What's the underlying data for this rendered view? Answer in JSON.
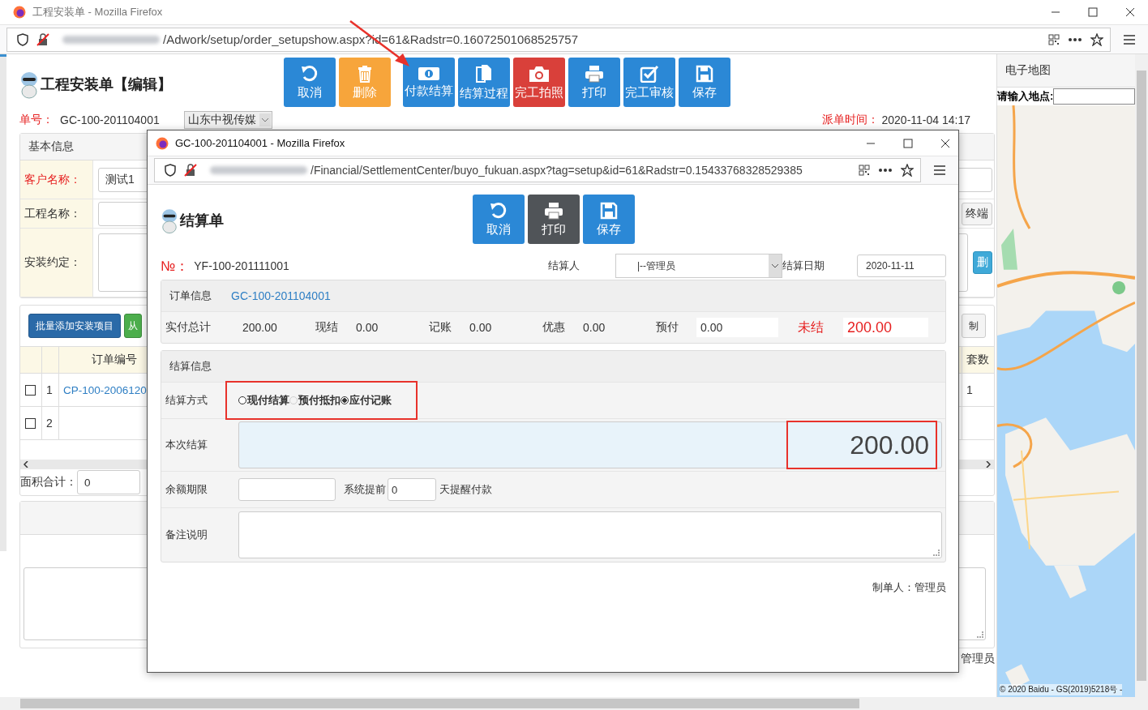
{
  "window": {
    "title": "工程安装单 - Mozilla Firefox",
    "url": "/Adwork/setup/order_setupshow.aspx?id=61&Radstr=0.16072501068525757"
  },
  "page": {
    "title": "工程安装单【编辑】",
    "toolbar": [
      {
        "label": "取消",
        "kind": "undo",
        "color": "#2b88d6",
        "pointed": false
      },
      {
        "label": "删除",
        "kind": "trash",
        "color": "#f7a53b",
        "pointed": false
      },
      {
        "label": "付款结算",
        "kind": "money",
        "color": "#2b88d6",
        "pointed": true
      },
      {
        "label": "结算过程",
        "kind": "document",
        "color": "#2b88d6",
        "pointed": false
      },
      {
        "label": "完工拍照",
        "kind": "camera",
        "color": "#d9403a",
        "pointed": false
      },
      {
        "label": "打印",
        "kind": "print",
        "color": "#2b88d6",
        "pointed": false
      },
      {
        "label": "完工审核",
        "kind": "check",
        "color": "#2b88d6",
        "pointed": false
      },
      {
        "label": "保存",
        "kind": "save",
        "color": "#2b88d6",
        "pointed": false
      }
    ],
    "order_no": {
      "label": "单号：",
      "value": "GC-100-201104001"
    },
    "company": {
      "value": "山东中视传媒"
    },
    "dispatch_time": {
      "label": "派单时间：",
      "value": "2020-11-04 14:17"
    },
    "basic_info": {
      "title": "基本信息",
      "fields": [
        {
          "label": "客户名称：",
          "required": true,
          "kind": "input",
          "value": "测试1"
        },
        {
          "label": "工程名称：",
          "required": false,
          "kind": "input",
          "button": {
            "label": "终端",
            "kind": "default"
          }
        },
        {
          "label": "安装约定：",
          "required": false,
          "kind": "textarea",
          "button": {
            "label": "删",
            "kind": "info"
          }
        }
      ]
    },
    "items": {
      "buttons": [
        {
          "label": "批量添加安装项目",
          "kind": "primary"
        },
        {
          "label": "从",
          "kind": "success"
        },
        {
          "label": "制",
          "kind": "default"
        }
      ],
      "columns": {
        "order_no": "订单编号",
        "sets": "套数"
      },
      "rows": [
        {
          "index": "1",
          "order_no": "CP-100-2006120",
          "sets": "1",
          "checked": false
        },
        {
          "index": "2",
          "checked": false
        }
      ],
      "area_total": {
        "label": "面积合计：",
        "value": "0"
      }
    },
    "footer": {
      "maker": "管理员"
    }
  },
  "map": {
    "title": "电子地图",
    "search_label": "请输入地点:",
    "copyright": "© 2020 Baidu - GS(2019)5218号 -"
  },
  "popup": {
    "title": "GC-100-201104001 - Mozilla Firefox",
    "url": "/Financial/SettlementCenter/buyo_fukuan.aspx?tag=setup&id=61&Radstr=0.15433768328529385",
    "heading": "结算单",
    "buttons": [
      {
        "label": "取消",
        "kind": "undo",
        "color": "#2b88d6"
      },
      {
        "label": "打印",
        "kind": "print",
        "color": "#505458"
      },
      {
        "label": "保存",
        "kind": "save",
        "color": "#2b88d6"
      }
    ],
    "number": {
      "label": "№：",
      "value": "YF-100-201111001"
    },
    "settler": {
      "label": "结算人",
      "value": "|--管理员"
    },
    "date": {
      "label": "结算日期",
      "value": "2020-11-11"
    },
    "order_info": {
      "title": "订单信息",
      "link": "GC-100-201104001",
      "amounts": [
        {
          "label": "实付总计",
          "value": "200.00",
          "kind": "text"
        },
        {
          "label": "现结",
          "value": "0.00",
          "kind": "text"
        },
        {
          "label": "记账",
          "value": "0.00",
          "kind": "text"
        },
        {
          "label": "优惠",
          "value": "0.00",
          "kind": "text"
        },
        {
          "label": "预付",
          "value": "0.00",
          "kind": "input"
        },
        {
          "label": "未结",
          "value": "200.00",
          "kind": "alert"
        }
      ]
    },
    "settlement": {
      "title": "结算信息",
      "method": {
        "label": "结算方式",
        "highlighted": true,
        "options": [
          {
            "label": "现付结算",
            "selected": false,
            "disabled": false
          },
          {
            "label": "预付抵扣",
            "selected": false,
            "disabled": true
          },
          {
            "label": "应付记账",
            "selected": true,
            "disabled": false
          }
        ]
      },
      "amount": {
        "label": "本次结算",
        "value": "200.00",
        "highlighted": true
      },
      "term": {
        "label": "余额期限",
        "remind_before": "系统提前",
        "remind_days": "0",
        "remind_after": "天提醒付款"
      },
      "remark": {
        "label": "备注说明"
      }
    },
    "maker": "制单人：管理员"
  }
}
